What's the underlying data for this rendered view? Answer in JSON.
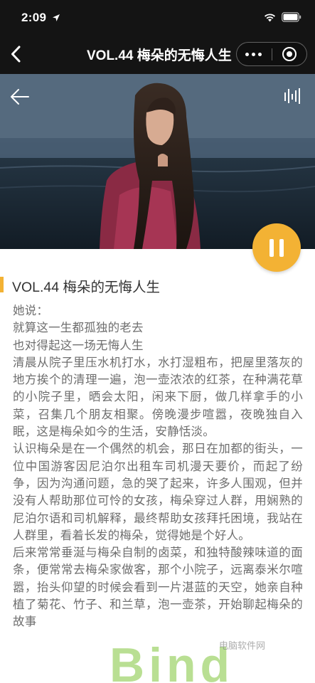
{
  "status_bar": {
    "time": "2:09",
    "icons": [
      "location-arrow-icon",
      "wifi-icon",
      "battery-icon"
    ]
  },
  "nav": {
    "title": "VOL.44 梅朵的无悔人生",
    "back_icon": "chevron-left-icon",
    "more_icon": "more-dots-icon",
    "close_icon": "close-miniprogram-icon"
  },
  "player": {
    "back_icon": "arrow-left-icon",
    "audio_icon": "audio-wave-icon",
    "state_icon": "pause-icon",
    "accent_color": "#f3b234"
  },
  "article": {
    "title": "VOL.44 梅朵的无悔人生",
    "paragraphs": [
      "她说：",
      "就算这一生都孤独的老去",
      "也对得起这一场无悔人生",
      "清晨从院子里压水机打水，水打湿粗布，把屋里落灰的地方挨个的清理一遍，泡一壶浓浓的红茶，在种满花草的小院子里，晒会太阳，闲来下厨，做几样拿手的小菜，召集几个朋友相聚。傍晚漫步喧嚣，夜晚独自入眠，这是梅朵如今的生活，安静恬淡。",
      "认识梅朵是在一个偶然的机会，那日在加都的街头，一位中国游客因尼泊尔出租车司机漫天要价，而起了纷争，因为沟通问题，急的哭了起来，许多人围观，但并没有人帮助那位可怜的女孩，梅朵穿过人群，用娴熟的尼泊尔语和司机解释，最终帮助女孩拜托困境，我站在人群里，看着长发的梅朵，觉得她是个好人。",
      "后来常常垂涎与梅朵自制的卤菜，和独特酸辣味道的面条，便常常去梅朵家做客，那个小院子，远离泰米尔喧嚣，抬头仰望的时候会看到一片湛蓝的天空，她亲自种植了菊花、竹子、和兰草，泡一壶茶，开始聊起梅朵的故事"
    ]
  },
  "watermark": {
    "text": "Bind",
    "subtext": "电脑软件网"
  }
}
